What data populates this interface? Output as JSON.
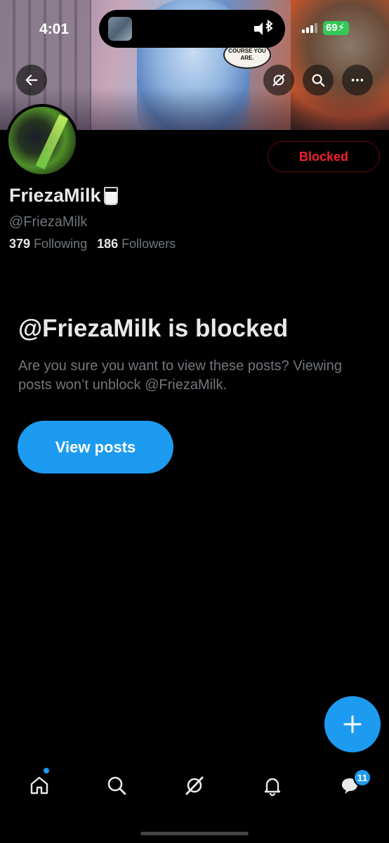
{
  "status_bar": {
    "time": "4:01",
    "battery": "69"
  },
  "banner": {
    "bubble_text": "COURSE YOU ARE."
  },
  "profile": {
    "blocked_button_label": "Blocked",
    "display_name": "FriezaMilk",
    "handle": "@FriezaMilk",
    "following_count": "379",
    "following_label": "Following",
    "followers_count": "186",
    "followers_label": "Followers"
  },
  "blocked_notice": {
    "title": "@FriezaMilk is blocked",
    "description": "Are you sure you want to view these posts? Viewing posts won’t unblock @FriezaMilk.",
    "view_posts_label": "View posts"
  },
  "tabbar": {
    "messages_badge": "11"
  },
  "colors": {
    "accent": "#1d9bf0",
    "blocked_red": "#f4212e",
    "muted": "#71767b",
    "background": "#000000"
  },
  "icons": [
    "back-arrow-icon",
    "grok-icon",
    "search-icon",
    "more-icon",
    "bluetooth-icon",
    "plus-icon",
    "home-icon",
    "explore-icon",
    "grok-tab-icon",
    "bell-icon",
    "messages-icon"
  ]
}
